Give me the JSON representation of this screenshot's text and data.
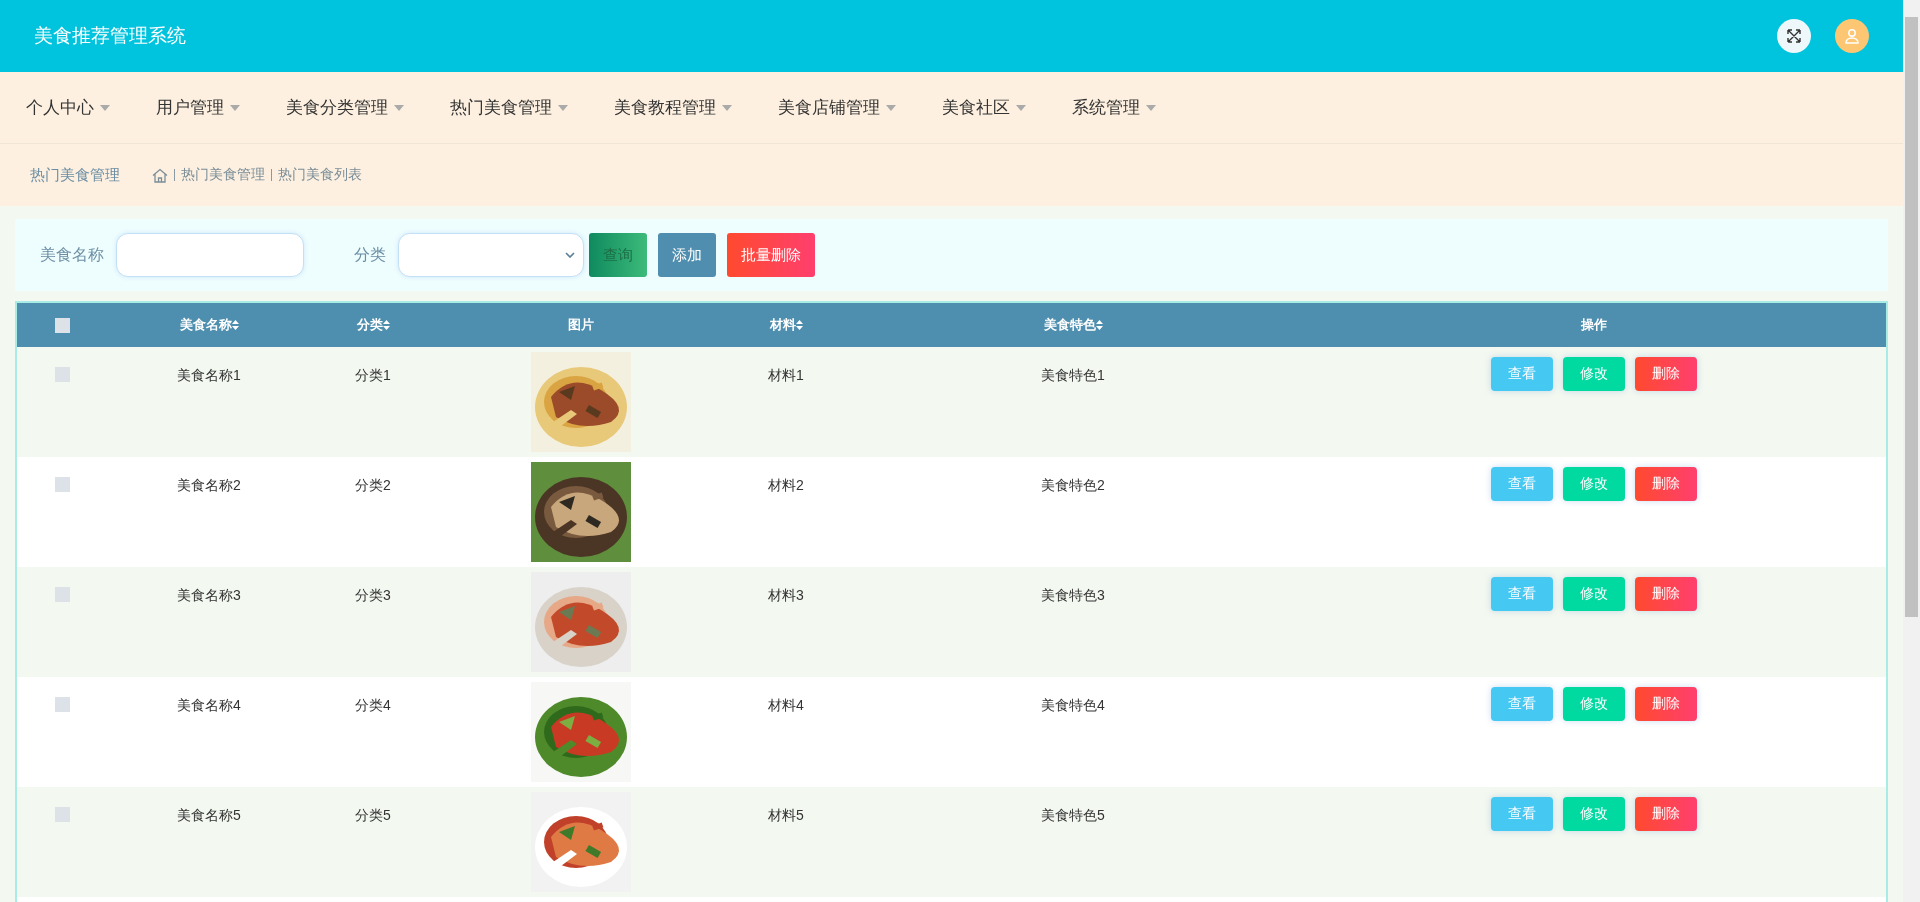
{
  "header": {
    "title": "美食推荐管理系统"
  },
  "menu": [
    {
      "label": "个人中心"
    },
    {
      "label": "用户管理"
    },
    {
      "label": "美食分类管理"
    },
    {
      "label": "热门美食管理"
    },
    {
      "label": "美食教程管理"
    },
    {
      "label": "美食店铺管理"
    },
    {
      "label": "美食社区"
    },
    {
      "label": "系统管理"
    }
  ],
  "breadcrumb": {
    "title": "热门美食管理",
    "path": [
      "热门美食管理",
      "热门美食列表"
    ]
  },
  "search": {
    "fields": [
      {
        "label": "美食名称",
        "kind": "text"
      },
      {
        "label": "分类",
        "kind": "select"
      }
    ],
    "buttons": [
      {
        "label": "查询",
        "kind": "search"
      },
      {
        "label": "添加",
        "kind": "add"
      },
      {
        "label": "批量删除",
        "kind": "delete"
      }
    ]
  },
  "table": {
    "select_all": {
      "checked": false
    },
    "columns": [
      {
        "label": "美食名称",
        "sortable": true
      },
      {
        "label": "分类",
        "sortable": true
      },
      {
        "label": "图片",
        "sortable": false
      },
      {
        "label": "材料",
        "sortable": true
      },
      {
        "label": "美食特色",
        "sortable": true
      },
      {
        "label": "操作",
        "sortable": false
      }
    ],
    "rows": [
      {
        "checked": false,
        "name": "美食名称1",
        "category": "分类1",
        "material": "材料1",
        "feature": "美食特色1",
        "actions": [
          {
            "label": "查看",
            "kind": "view"
          },
          {
            "label": "修改",
            "kind": "edit"
          },
          {
            "label": "删除",
            "kind": "delete"
          }
        ]
      },
      {
        "checked": false,
        "name": "美食名称2",
        "category": "分类2",
        "material": "材料2",
        "feature": "美食特色2",
        "actions": [
          {
            "label": "查看",
            "kind": "view"
          },
          {
            "label": "修改",
            "kind": "edit"
          },
          {
            "label": "删除",
            "kind": "delete"
          }
        ]
      },
      {
        "checked": false,
        "name": "美食名称3",
        "category": "分类3",
        "material": "材料3",
        "feature": "美食特色3",
        "actions": [
          {
            "label": "查看",
            "kind": "view"
          },
          {
            "label": "修改",
            "kind": "edit"
          },
          {
            "label": "删除",
            "kind": "delete"
          }
        ]
      },
      {
        "checked": false,
        "name": "美食名称4",
        "category": "分类4",
        "material": "材料4",
        "feature": "美食特色4",
        "actions": [
          {
            "label": "查看",
            "kind": "view"
          },
          {
            "label": "修改",
            "kind": "edit"
          },
          {
            "label": "删除",
            "kind": "delete"
          }
        ]
      },
      {
        "checked": false,
        "name": "美食名称5",
        "category": "分类5",
        "material": "材料5",
        "feature": "美食特色5",
        "actions": [
          {
            "label": "查看",
            "kind": "view"
          },
          {
            "label": "修改",
            "kind": "edit"
          },
          {
            "label": "删除",
            "kind": "delete"
          }
        ]
      }
    ]
  }
}
